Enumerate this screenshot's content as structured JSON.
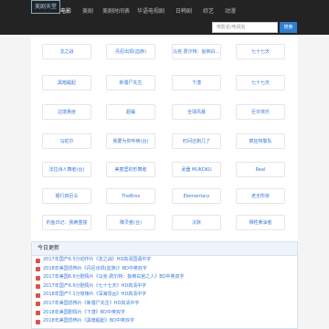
{
  "navbar": {
    "brand": "美剧天堂",
    "items": [
      {
        "label": "电影",
        "active": true
      },
      {
        "label": "美剧",
        "active": false
      },
      {
        "label": "美剧时间表",
        "active": false
      },
      {
        "label": "华语电视剧",
        "active": false
      },
      {
        "label": "日韩剧",
        "active": false
      },
      {
        "label": "综艺",
        "active": false
      },
      {
        "label": "动漫",
        "active": false
      }
    ],
    "search_placeholder": "电影名/电视名",
    "search_button": "搜索"
  },
  "shows": [
    "龙之战",
    "丹尼出现(血族)",
    "马克·费尔特：扳倒白宫之人",
    "七十七天",
    "黑暗崛起",
    "新僵尸先生",
    "下潜",
    "七十七天",
    "边境悬崖",
    "超蛹",
    "全球风暴",
    "巨日侠乐",
    "马蛇尔",
    "我要为你呼唤(台)",
    "时间还剩几了",
    "疯狂特警队",
    "法拉诗人舞者(台)",
    "美丽里的形舞者",
    "武器 MUKOKU",
    "Real",
    "银行四巨头",
    "TheBros",
    "Elementary",
    "老无所依",
    "钓鱼日记：我两重撞",
    "降灵者(台)",
    "沉默",
    "牺牲黄油者"
  ],
  "today_updates": {
    "title": "今日更新",
    "items": [
      "2017年国产6.5分动作片《龙之战》HD高清国语中字",
      "2018年美国恐怖片《丹尼出现(血族)》BD中英双字",
      "2017年美国6.6分剧情片《马克·费尔特：扳倒白宫之人》BD中英双字",
      "2017年国产6.6分剧情片《七十七天》HD高清中字",
      "2018年国产7.1分惊悚片《深海恐凶》HD高清中字",
      "2017年美国恐怖片《新僵尸先生》HD高清中字",
      "2018年美国剧情片《下潜》BD中英双字",
      "2018年美国恐怖片《黑暗崛起》BD中英双字"
    ]
  }
}
